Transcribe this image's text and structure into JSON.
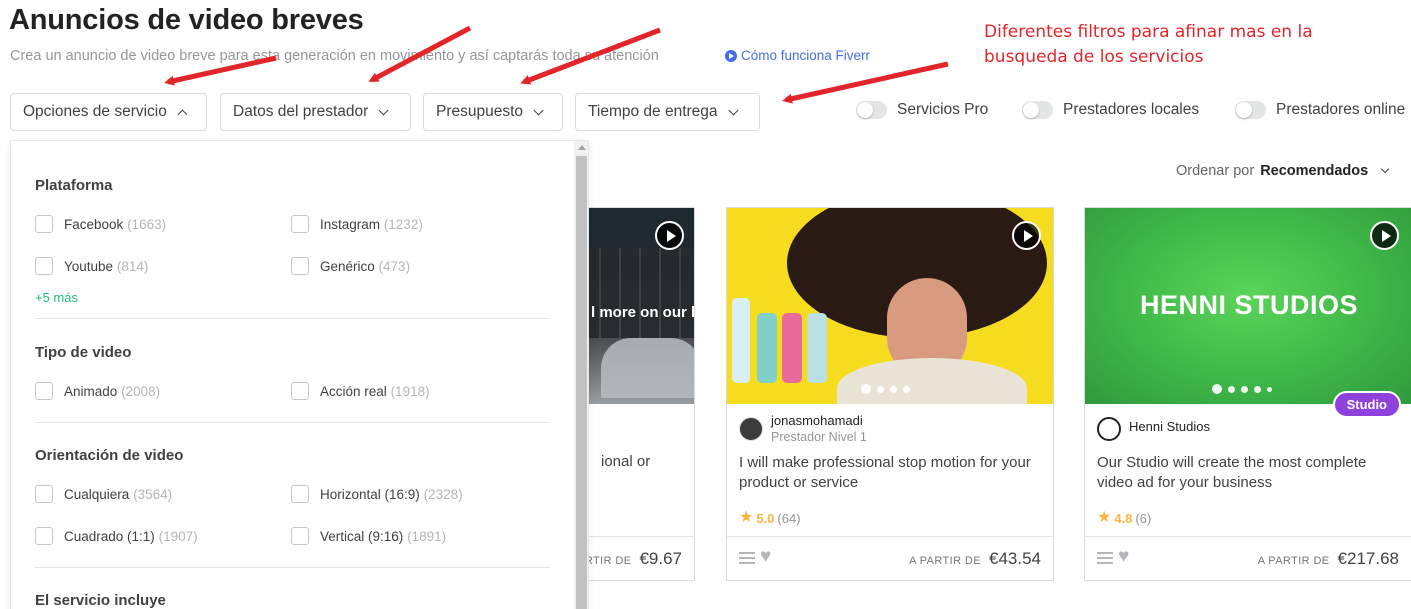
{
  "page": {
    "title": "Anuncios de video breves",
    "subtitle": "Crea un anuncio de video breve para esta generación en movimiento y así captarás toda su atención",
    "how_link": "Cómo funciona Fiverr"
  },
  "annotation": "Diferentes filtros para afinar mas en la busqueda de los servicios",
  "filters": {
    "service_options": "Opciones de servicio",
    "seller_details": "Datos del prestador",
    "budget": "Presupuesto",
    "delivery_time": "Tiempo de entrega"
  },
  "toggles": {
    "pro": "Servicios Pro",
    "local": "Prestadores locales",
    "online": "Prestadores online"
  },
  "sort": {
    "label": "Ordenar por",
    "value": "Recomendados"
  },
  "dropdown": {
    "platform": {
      "title": "Plataforma",
      "options": [
        {
          "label": "Facebook",
          "count": "(1663)"
        },
        {
          "label": "Instagram",
          "count": "(1232)"
        },
        {
          "label": "Youtube",
          "count": "(814)"
        },
        {
          "label": "Genérico",
          "count": "(473)"
        }
      ],
      "more": "+5 más"
    },
    "video_type": {
      "title": "Tipo de video",
      "options": [
        {
          "label": "Animado",
          "count": "(2008)"
        },
        {
          "label": "Acción real",
          "count": "(1918)"
        }
      ]
    },
    "orientation": {
      "title": "Orientación de video",
      "options": [
        {
          "label": "Cualquiera",
          "count": "(3564)"
        },
        {
          "label": "Horizontal (16:9)",
          "count": "(2328)"
        },
        {
          "label": "Cuadrado (1:1)",
          "count": "(1907)"
        },
        {
          "label": "Vertical (9:16)",
          "count": "(1891)"
        }
      ]
    },
    "includes": {
      "title": "El servicio incluye"
    }
  },
  "cards": [
    {
      "image_text": "l more on our b",
      "title_fragment": "ional or",
      "price_from": "RTIR DE",
      "price": "€9.67"
    },
    {
      "seller_name": "jonasmohamadi",
      "seller_level": "Prestador Nivel 1",
      "title": "I will make professional stop motion for your product or service",
      "rating": "5.0",
      "rating_count": "(64)",
      "price_from": "A PARTIR DE",
      "price": "€43.54"
    },
    {
      "image_text": "HENNI STUDIOS",
      "badge": "Studio",
      "seller_name": "Henni Studios",
      "title": "Our Studio will create the most complete video ad for your business",
      "rating": "4.8",
      "rating_count": "(6)",
      "price_from": "A PARTIR DE",
      "price": "€217.68"
    }
  ],
  "colors": {
    "accent_green": "#1dbf73",
    "annotation_red": "#e2252b",
    "star": "#ffb33e",
    "studio_badge": "#8f41dc",
    "link_blue": "#446ee7"
  }
}
